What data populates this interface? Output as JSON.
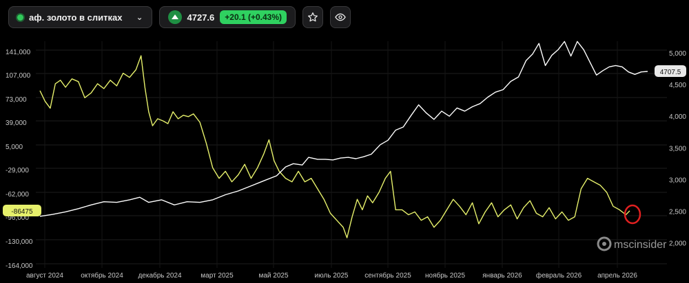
{
  "header": {
    "instrument": "аф. золото в слитках",
    "price": "4727.6",
    "change": "+20.1 (+0.43%)"
  },
  "colors": {
    "background": "#000000",
    "gold_series": "#e6f06b",
    "price_series": "#ffffff",
    "positive": "#2fd160",
    "marker": "#e02020"
  },
  "chart_data": {
    "type": "line",
    "x_labels": [
      "август 2024",
      "октябрь 2024",
      "декабрь 2024",
      "март 2025",
      "май 2025",
      "июль 2025",
      "сентябрь 2025",
      "ноябрь 2025",
      "январь 2026",
      "февраль 2026",
      "апрель 2026"
    ],
    "y_left": {
      "ticks": [
        "141,000",
        "107,000",
        "73,000",
        "39,000",
        "5,000",
        "-29,000",
        "-62,000",
        "-96,000",
        "-130,000",
        "-164,000"
      ],
      "range": [
        -164000,
        141000
      ]
    },
    "y_right": {
      "ticks": [
        "5,000",
        "4,500",
        "4,000",
        "3,500",
        "3,000",
        "2,500",
        "2,000"
      ],
      "range": [
        2000,
        5000
      ]
    },
    "last_value_left": "-86475",
    "last_value_right": "4707.5",
    "grid": true,
    "series": [
      {
        "axis": "left",
        "color": "#e6f06b",
        "points": [
          [
            0.0,
            85000
          ],
          [
            0.4,
            70000
          ],
          [
            0.8,
            60000
          ],
          [
            1.2,
            95000
          ],
          [
            1.6,
            100000
          ],
          [
            2.0,
            90000
          ],
          [
            2.5,
            102000
          ],
          [
            3.0,
            98000
          ],
          [
            3.5,
            75000
          ],
          [
            4.0,
            82000
          ],
          [
            4.5,
            95000
          ],
          [
            5.0,
            88000
          ],
          [
            5.5,
            100000
          ],
          [
            6.0,
            92000
          ],
          [
            6.5,
            110000
          ],
          [
            7.0,
            104000
          ],
          [
            7.5,
            115000
          ],
          [
            7.9,
            135000
          ],
          [
            8.2,
            90000
          ],
          [
            8.5,
            55000
          ],
          [
            8.8,
            35000
          ],
          [
            9.2,
            45000
          ],
          [
            9.6,
            42000
          ],
          [
            10.0,
            38000
          ],
          [
            10.4,
            55000
          ],
          [
            10.8,
            45000
          ],
          [
            11.2,
            50000
          ],
          [
            11.6,
            48000
          ],
          [
            12.0,
            52000
          ],
          [
            12.5,
            40000
          ],
          [
            13.0,
            10000
          ],
          [
            13.5,
            -25000
          ],
          [
            14.0,
            -40000
          ],
          [
            14.5,
            -30000
          ],
          [
            15.0,
            -45000
          ],
          [
            15.5,
            -35000
          ],
          [
            16.0,
            -20000
          ],
          [
            16.5,
            -40000
          ],
          [
            17.0,
            -25000
          ],
          [
            17.5,
            -5000
          ],
          [
            17.9,
            15000
          ],
          [
            18.3,
            -15000
          ],
          [
            18.7,
            -30000
          ],
          [
            19.2,
            -40000
          ],
          [
            19.7,
            -45000
          ],
          [
            20.2,
            -30000
          ],
          [
            20.7,
            -45000
          ],
          [
            21.2,
            -40000
          ],
          [
            21.7,
            -55000
          ],
          [
            22.2,
            -70000
          ],
          [
            22.7,
            -90000
          ],
          [
            23.2,
            -100000
          ],
          [
            23.7,
            -110000
          ],
          [
            24.0,
            -125000
          ],
          [
            24.4,
            -95000
          ],
          [
            24.8,
            -70000
          ],
          [
            25.2,
            -85000
          ],
          [
            25.6,
            -65000
          ],
          [
            26.0,
            -75000
          ],
          [
            26.5,
            -60000
          ],
          [
            27.0,
            -40000
          ],
          [
            27.4,
            -30000
          ],
          [
            27.8,
            -85000
          ],
          [
            28.3,
            -85000
          ],
          [
            28.8,
            -92000
          ],
          [
            29.3,
            -88000
          ],
          [
            29.8,
            -100000
          ],
          [
            30.3,
            -95000
          ],
          [
            30.8,
            -110000
          ],
          [
            31.3,
            -100000
          ],
          [
            31.8,
            -85000
          ],
          [
            32.3,
            -70000
          ],
          [
            32.8,
            -80000
          ],
          [
            33.3,
            -92000
          ],
          [
            33.8,
            -75000
          ],
          [
            34.3,
            -105000
          ],
          [
            34.8,
            -88000
          ],
          [
            35.3,
            -75000
          ],
          [
            35.8,
            -95000
          ],
          [
            36.3,
            -85000
          ],
          [
            36.8,
            -78000
          ],
          [
            37.3,
            -98000
          ],
          [
            37.8,
            -82000
          ],
          [
            38.3,
            -72000
          ],
          [
            38.8,
            -90000
          ],
          [
            39.3,
            -95000
          ],
          [
            39.8,
            -82000
          ],
          [
            40.3,
            -98000
          ],
          [
            40.8,
            -88000
          ],
          [
            41.3,
            -100000
          ],
          [
            41.8,
            -95000
          ],
          [
            42.3,
            -55000
          ],
          [
            42.8,
            -40000
          ],
          [
            43.3,
            -45000
          ],
          [
            43.8,
            -50000
          ],
          [
            44.3,
            -60000
          ],
          [
            44.8,
            -80000
          ],
          [
            45.3,
            -85000
          ],
          [
            45.8,
            -92000
          ],
          [
            46.1,
            -86475
          ]
        ]
      },
      {
        "axis": "right",
        "color": "#ffffff",
        "points": [
          [
            0.0,
            2420
          ],
          [
            1.0,
            2450
          ],
          [
            2.0,
            2490
          ],
          [
            3.0,
            2540
          ],
          [
            4.0,
            2600
          ],
          [
            5.0,
            2650
          ],
          [
            6.0,
            2640
          ],
          [
            7.0,
            2680
          ],
          [
            7.8,
            2720
          ],
          [
            8.5,
            2640
          ],
          [
            9.5,
            2680
          ],
          [
            10.5,
            2600
          ],
          [
            11.5,
            2650
          ],
          [
            12.5,
            2640
          ],
          [
            13.5,
            2680
          ],
          [
            14.5,
            2760
          ],
          [
            15.5,
            2820
          ],
          [
            16.5,
            2900
          ],
          [
            17.5,
            2980
          ],
          [
            18.5,
            3060
          ],
          [
            19.2,
            3200
          ],
          [
            19.8,
            3250
          ],
          [
            20.5,
            3230
          ],
          [
            21.0,
            3350
          ],
          [
            21.7,
            3320
          ],
          [
            22.3,
            3320
          ],
          [
            22.9,
            3310
          ],
          [
            23.5,
            3340
          ],
          [
            24.1,
            3350
          ],
          [
            24.7,
            3330
          ],
          [
            25.3,
            3360
          ],
          [
            25.9,
            3400
          ],
          [
            26.6,
            3550
          ],
          [
            27.2,
            3620
          ],
          [
            27.8,
            3780
          ],
          [
            28.4,
            3830
          ],
          [
            29.0,
            4010
          ],
          [
            29.6,
            4180
          ],
          [
            30.2,
            4050
          ],
          [
            30.8,
            3950
          ],
          [
            31.4,
            4080
          ],
          [
            32.0,
            4000
          ],
          [
            32.6,
            4130
          ],
          [
            33.2,
            4080
          ],
          [
            33.8,
            4150
          ],
          [
            34.4,
            4200
          ],
          [
            35.0,
            4300
          ],
          [
            35.6,
            4380
          ],
          [
            36.2,
            4420
          ],
          [
            36.8,
            4550
          ],
          [
            37.4,
            4620
          ],
          [
            38.0,
            4880
          ],
          [
            38.5,
            4980
          ],
          [
            39.0,
            5150
          ],
          [
            39.5,
            4800
          ],
          [
            40.0,
            4960
          ],
          [
            40.5,
            5050
          ],
          [
            41.0,
            5180
          ],
          [
            41.5,
            4950
          ],
          [
            42.0,
            5180
          ],
          [
            42.5,
            5050
          ],
          [
            43.0,
            4850
          ],
          [
            43.5,
            4650
          ],
          [
            44.0,
            4720
          ],
          [
            44.5,
            4780
          ],
          [
            45.0,
            4800
          ],
          [
            45.5,
            4780
          ],
          [
            46.0,
            4700
          ],
          [
            46.5,
            4660
          ],
          [
            47.0,
            4700
          ],
          [
            47.5,
            4707.5
          ]
        ]
      }
    ]
  },
  "watermark": "mscinsider"
}
